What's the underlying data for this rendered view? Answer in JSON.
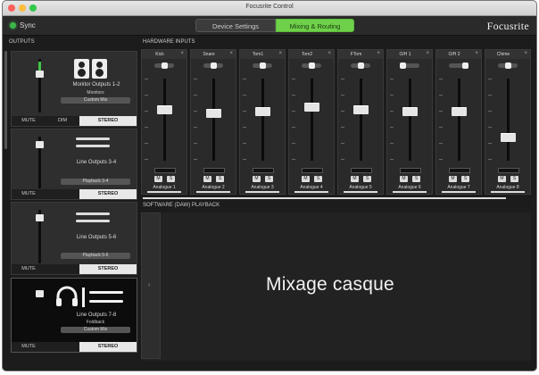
{
  "window": {
    "title": "Focusrite Control",
    "lights": [
      "#fc605b",
      "#fdbc40",
      "#34c84a"
    ]
  },
  "toolbar": {
    "sync_label": "Sync",
    "tabs": [
      {
        "label": "Device Settings"
      },
      {
        "label": "Mixing & Routing"
      }
    ],
    "brand": "Focusrite"
  },
  "sections": {
    "outputs": "OUTPUTS",
    "hardware_inputs": "HARDWARE INPUTS",
    "software_playback": "SOFTWARE (DAW) PLAYBACK"
  },
  "outputs": [
    {
      "name": "Monitor Outputs 1-2",
      "sub": "Monitors",
      "source": "Custom Mix",
      "mute": "MUTE",
      "dim": "DIM",
      "mode": "STEREO",
      "level": 0.72,
      "meter": 0.3
    },
    {
      "name": "Line Outputs 3-4",
      "sub": "",
      "source": "Playback 3-4",
      "mute": "MUTE",
      "mode": "STEREO",
      "level": 0.85,
      "meter": 0
    },
    {
      "name": "Line Outputs 5-6",
      "sub": "",
      "source": "Playback 5-6",
      "mute": "MUTE",
      "mode": "STEREO",
      "level": 0.85,
      "meter": 0
    },
    {
      "name": "Line Outputs 7-8",
      "sub": "Foldback",
      "source": "Custom Mix",
      "mute": "MUTE",
      "mode": "STEREO",
      "level": 0.85,
      "meter": 0
    }
  ],
  "inputs": [
    {
      "name": "Kick",
      "pan": 0.5,
      "level": 0.62,
      "source": "Analogue 1",
      "mute": "M",
      "solo": "S"
    },
    {
      "name": "Snare",
      "pan": 0.5,
      "level": 0.58,
      "source": "Analogue 2",
      "mute": "M",
      "solo": "S"
    },
    {
      "name": "Tom1",
      "pan": 0.5,
      "level": 0.6,
      "source": "Analogue 3",
      "mute": "M",
      "solo": "S"
    },
    {
      "name": "Tom2",
      "pan": 0.5,
      "level": 0.65,
      "source": "Analogue 4",
      "mute": "M",
      "solo": "S"
    },
    {
      "name": "FTom",
      "pan": 0.5,
      "level": 0.62,
      "source": "Analogue 5",
      "mute": "M",
      "solo": "S"
    },
    {
      "name": "O/H 1",
      "pan": 0.15,
      "level": 0.6,
      "source": "Analogue 6",
      "mute": "M",
      "solo": "S"
    },
    {
      "name": "O/H 2",
      "pan": 0.85,
      "level": 0.6,
      "source": "Analogue 7",
      "mute": "M",
      "solo": "S"
    },
    {
      "name": "Chime",
      "pan": 0.5,
      "level": 0.28,
      "source": "Analogue 8",
      "mute": "M",
      "solo": "S"
    }
  ],
  "overlay_text": "Mixage casque"
}
